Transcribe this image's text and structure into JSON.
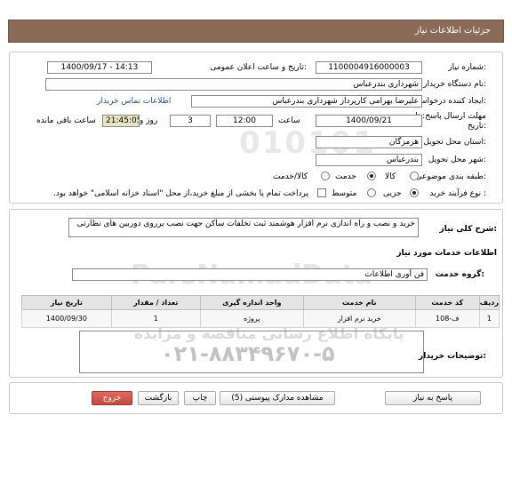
{
  "page": {
    "header": "جزئیات اطلاعات نیاز"
  },
  "info": {
    "need_number_label": "شماره نیاز:",
    "need_number": "1100004916000003",
    "announce_label": "تاریخ و ساعت اعلان عمومی:",
    "announce_value": "1400/09/17 - 14:13",
    "buyer_label": "نام دستگاه خریدار:",
    "buyer_value": "شهرداری بندرعباس",
    "requester_label": "ایجاد کننده درخواست:",
    "requester_value": "علیرضا بهرامی کارپرداز شهرداری بندرعباس",
    "contact_link": "اطلاعات تماس خریدار",
    "deadline_label_1": "مهلت ارسال پاسخ: تا",
    "deadline_label_2": "تاریخ:",
    "deadline_date": "1400/09/21",
    "hour_label": "ساعت",
    "deadline_time": "12:00",
    "days_value": "3",
    "days_label": "روز و",
    "remaining_time": "21:45:05",
    "remaining_label": "ساعت باقی مانده",
    "province_label": "استان محل تحویل:",
    "province_value": "هرمزگان",
    "city_label": "شهر محل تحویل:",
    "city_value": "بندرعباس",
    "category_label": "طبقه بندی موضوعی:",
    "category_options": [
      "کالا",
      "خدمت",
      "کالا/خدمت"
    ],
    "category_selected": "خدمت",
    "process_label": "نوع فرآیند خرید :",
    "process_options": [
      "جزیی",
      "متوسط"
    ],
    "process_selected": "جزیی",
    "payment_note": "پرداخت تمام یا بخشی از مبلغ خرید،از محل \"اسناد خزانه اسلامی\" خواهد بود."
  },
  "details": {
    "summary_label": "شرح کلی نیاز:",
    "summary_value": "خرید و نصب و راه اندازی نرم افزار هوشمند ثبت تخلفات ساکن جهت نصب برروی دوربین های نظارتی",
    "services_heading": "اطلاعات خدمات مورد نیاز",
    "group_label": "گروه خدمت:",
    "group_value": "فن آوری اطلاعات",
    "table": {
      "headers": [
        "ردیف",
        "کد خدمت",
        "نام خدمت",
        "واحد اندازه گیری",
        "تعداد / مقدار",
        "تاریخ نیاز"
      ],
      "rows": [
        [
          "1",
          "ف-108",
          "خرید نرم افزار",
          "پروژه",
          "1",
          "1400/09/30"
        ]
      ]
    },
    "buyer_notes_label": "توضیحات خریدار:"
  },
  "watermark": {
    "line1": "ParsNamadData",
    "line2": "پایگاه اطلاع رسانی مناقصه و مزایده",
    "phone": "۰۲۱-۸۸۳۴۹۶۷۰-۵",
    "num": "010101"
  },
  "actions": {
    "reply": "پاسخ به نیاز",
    "docs": "مشاهده مدارک پیوستی (5)",
    "print": "چاپ",
    "back": "بازگشت",
    "exit": "خروج"
  }
}
